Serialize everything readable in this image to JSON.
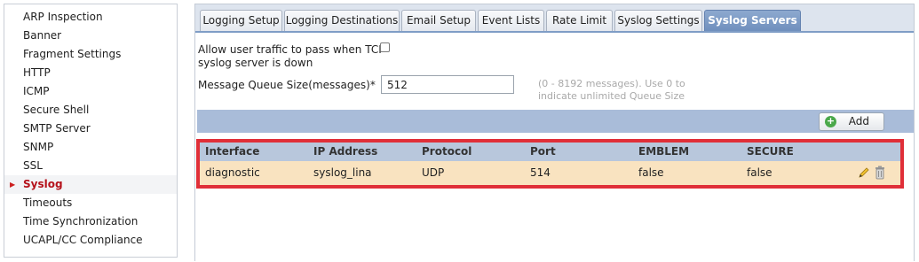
{
  "sidebar": {
    "items": [
      {
        "label": "ARP Inspection"
      },
      {
        "label": "Banner"
      },
      {
        "label": "Fragment Settings"
      },
      {
        "label": "HTTP"
      },
      {
        "label": "ICMP"
      },
      {
        "label": "Secure Shell"
      },
      {
        "label": "SMTP Server"
      },
      {
        "label": "SNMP"
      },
      {
        "label": "SSL"
      },
      {
        "label": "Syslog",
        "active": true
      },
      {
        "label": "Timeouts"
      },
      {
        "label": "Time Synchronization"
      },
      {
        "label": "UCAPL/CC Compliance"
      }
    ]
  },
  "tabs": [
    {
      "label": "Logging Setup"
    },
    {
      "label": "Logging Destinations"
    },
    {
      "label": "Email Setup"
    },
    {
      "label": "Event Lists"
    },
    {
      "label": "Rate Limit"
    },
    {
      "label": "Syslog Settings"
    },
    {
      "label": "Syslog Servers",
      "active": true
    }
  ],
  "settings": {
    "allow_traffic_label_line1": "Allow user traffic to pass when TCP",
    "allow_traffic_label_line2": "syslog server is down",
    "allow_traffic_checked": false,
    "queue_size_label": "Message Queue Size(messages)*",
    "queue_size_value": "512",
    "queue_hint_line1": "(0 - 8192 messages). Use 0 to",
    "queue_hint_line2": "indicate unlimited Queue Size"
  },
  "toolbar": {
    "add_label": "Add"
  },
  "table": {
    "columns": [
      "Interface",
      "IP Address",
      "Protocol",
      "Port",
      "EMBLEM",
      "SECURE"
    ],
    "rows": [
      [
        "diagnostic",
        "syslog_lina",
        "UDP",
        "514",
        "false",
        "false"
      ]
    ]
  },
  "colors": {
    "highlight_border": "#e02f38",
    "row_highlight": "#f9e3c0",
    "active_tab": "#7f9dc6",
    "active_sidebar_text": "#b5121b"
  }
}
